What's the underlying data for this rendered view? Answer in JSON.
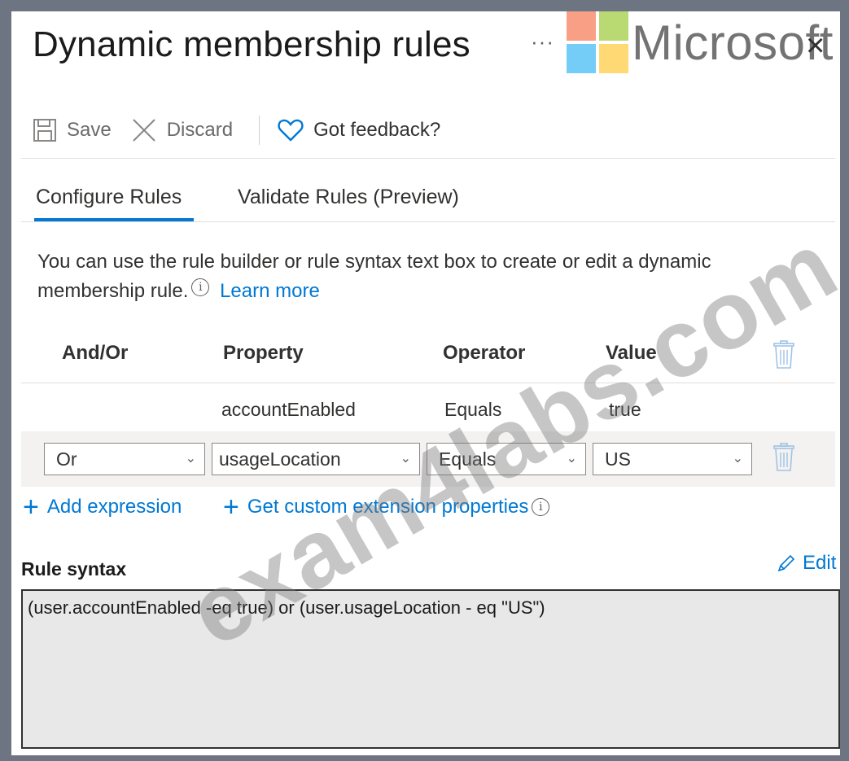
{
  "panel": {
    "title": "Dynamic membership rules",
    "more": "···",
    "brand": "Microsoft",
    "close": "×"
  },
  "toolbar": {
    "save_label": "Save",
    "discard_label": "Discard",
    "feedback_label": "Got feedback?"
  },
  "tabs": [
    {
      "label": "Configure Rules",
      "active": true
    },
    {
      "label": "Validate Rules (Preview)",
      "active": false
    }
  ],
  "description": {
    "text": "You can use the rule builder or rule syntax text box to create or edit a dynamic membership rule.",
    "learn_more": "Learn more"
  },
  "table": {
    "headers": [
      "And/Or",
      "Property",
      "Operator",
      "Value"
    ],
    "row1": {
      "property": "accountEnabled",
      "operator": "Equals",
      "value": "true"
    },
    "row2": {
      "andor": "Or",
      "property": "usageLocation",
      "operator": "Equals",
      "value": "US"
    }
  },
  "actions": {
    "add_expression": "Add expression",
    "custom_extension": "Get custom extension properties"
  },
  "rule_syntax": {
    "label": "Rule syntax",
    "edit_label": "Edit",
    "text": "(user.accountEnabled -eq true) or (user.usageLocation - eq \"US\")"
  },
  "watermark": "exam4labs.com",
  "colors": {
    "accent": "#0078d4",
    "ms_red": "#f25022",
    "ms_green": "#7fba00",
    "ms_blue": "#00a4ef",
    "ms_yellow": "#ffb900"
  }
}
